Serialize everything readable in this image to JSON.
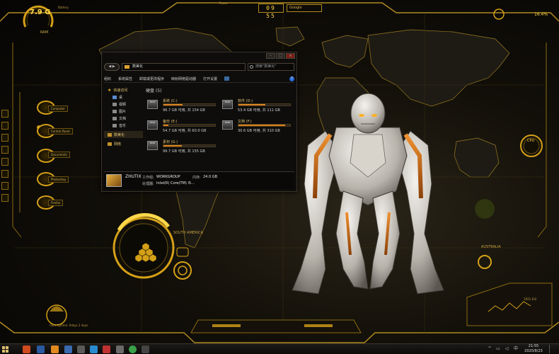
{
  "hud": {
    "ram_value": "7.9 G",
    "ram_label": "RAM",
    "clock": "09 55",
    "search_label": "Google",
    "cpu_percent": "16.4%",
    "cpu_label": "CPU",
    "battery_label": "Battery",
    "power_label": "Power",
    "continent_label": "SOUTH AMERICA",
    "australia_label": "AUSTRALIA",
    "menu_buttons": [
      "Computer",
      "Control Panel",
      "Documents",
      "Photoshop",
      "Firefox"
    ],
    "uptime_label": "Core Uptime: 0days 2 days",
    "speed_label": "1921.8 B"
  },
  "explorer": {
    "title_location": "数美化",
    "address_path": "数美化",
    "search_placeholder": "搜索\"数美化\"",
    "toolbar": [
      "组织",
      "系统属性",
      "卸载或更改程序",
      "映射网络驱动器",
      "打开设置"
    ],
    "nav": {
      "quick_access": "快速访问",
      "items": [
        "桌",
        "视频",
        "图片",
        "文档",
        "音乐"
      ],
      "this_pc": "数美化",
      "network": "网络"
    },
    "group_title": "硬盘 (5)",
    "drives": [
      {
        "name": "系统 (C:)",
        "info": "96.7 GB 可用, 共 154 GB",
        "used": 0.37
      },
      {
        "name": "软件 (D:)",
        "info": "53.4 GB 可用, 共 111 GB",
        "used": 0.52
      },
      {
        "name": "备份 (E:)",
        "info": "54.7 GB 可用, 共 60.0 GB",
        "used": 0.09
      },
      {
        "name": "文档 (F:)",
        "info": "30.6 GB 可用, 共 310 GB",
        "used": 0.9
      },
      {
        "name": "素材 (G:)",
        "info": "99.7 GB 可用, 共 155 GB",
        "used": 0.36
      }
    ],
    "details": {
      "pc_name": "ZHUTIX",
      "workgroup_label": "工作组:",
      "workgroup_value": "WORKGROUP",
      "memory_label": "内存:",
      "memory_value": "24.0 GB",
      "cpu_label": "处理器:",
      "cpu_value": "Intel(R) Core(TM) i5..."
    }
  },
  "taskbar": {
    "time": "21:55",
    "date": "2020/8/23",
    "ime": "中"
  }
}
